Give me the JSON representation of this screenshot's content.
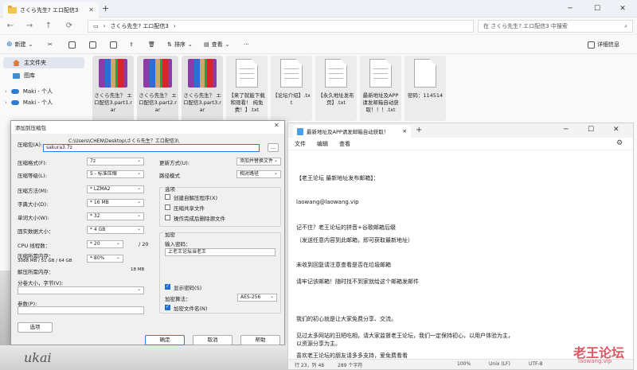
{
  "explorer": {
    "tab_title": "さくら先生? エロ配信3",
    "address": "さくら先生? エロ配信3",
    "search_placeholder": "在 さくら先生? エロ配信3 中搜索",
    "toolbar": {
      "new": "新建",
      "sort": "排序",
      "view": "查看",
      "more": "···",
      "details": "详细信息"
    },
    "sidebar": [
      {
        "label": "主文件夹",
        "icon": "home-icon"
      },
      {
        "label": "图库",
        "icon": "gallery-icon"
      },
      {
        "label": "Maki - 个人",
        "icon": "cloud-icon"
      },
      {
        "label": "Maki - 个人",
        "icon": "cloud-icon"
      }
    ],
    "files": [
      {
        "name": "さくら先生？ エロ配信3.part1.rar",
        "type": "rar"
      },
      {
        "name": "さくら先生？ エロ配信3.part2.rar",
        "type": "rar"
      },
      {
        "name": "さくら先生？ エロ配信3.part3.rar",
        "type": "rar"
      },
      {
        "name": "【来了就能下载和观看！ 纯免费！】.txt",
        "type": "txt"
      },
      {
        "name": "【论坛介绍】.txt",
        "type": "txt"
      },
      {
        "name": "【永久地址发布页】.txt",
        "type": "txt"
      },
      {
        "name": "最新地址及APP请发邮箱自动获取！！！.txt",
        "type": "txt"
      },
      {
        "name": "密码：114514",
        "type": "file"
      }
    ]
  },
  "dialog": {
    "title": "添加到压缩包",
    "archive_label": "压缩包(A):",
    "archive_path": "C:\\Users\\CHEN\\Desktop\\さくら先生？エロ配信3\\",
    "archive_name": "sakura3.7z",
    "browse": "...",
    "format_label": "压缩格式(F):",
    "format_value": "7z",
    "level_label": "压缩等级(L):",
    "level_value": "5 - 标准压缩",
    "method_label": "压缩方法(M):",
    "method_value": "* LZMA2",
    "dict_label": "字典大小(D):",
    "dict_value": "* 16 MB",
    "word_label": "单词大小(W):",
    "word_value": "* 32",
    "solid_label": "固实数据大小：",
    "solid_value": "* 4 GB",
    "cpu_label": "CPU 线程数：",
    "cpu_value": "* 20",
    "cpu_total": "/ 20",
    "mem_comp_label": "压缩所需内存：",
    "mem_comp_value": "3088 MB / 51 GB / 64 GB",
    "mem_percent": "* 80%",
    "mem_decomp_label": "解压所需内存：",
    "mem_decomp_value": "18 MB",
    "split_label": "分卷大小，字节(V):",
    "params_label": "参数(P):",
    "options_btn": "选项",
    "update_label": "更新方式(U):",
    "update_value": "添加并替换文件",
    "path_label": "路径模式",
    "path_value": "相对路径",
    "options_group": "选项",
    "opt_sfx": "创建自解压程序(X)",
    "opt_shared": "压缩共享文件",
    "opt_delete": "操作完成后删除源文件",
    "encrypt_group": "加密",
    "password_label": "输入密码：",
    "password_value": "上老王论坛当老王",
    "show_password": "显示密码(S)",
    "method_enc_label": "加密算法：",
    "method_enc_value": "AES-256",
    "encrypt_names": "加密文件名(N)",
    "ok": "确定",
    "cancel": "取消",
    "help": "帮助"
  },
  "notepad": {
    "tab_title": "最新地址及APP请发邮箱自动获取！",
    "menu": [
      "文件",
      "编辑",
      "查看"
    ],
    "lines": [
      "【老王论坛 最新地址发布邮箱】：",
      "laowang@laowang.vip",
      "记不住？老王论坛的拼音+谷歌邮箱后缀",
      "（发送任意内容到此邮箱，即可获取最新地址）",
      "未收到回复请注意查看是否在垃圾邮箱",
      "请牢记该邮箱！随时找不到家就给这个邮箱发邮件",
      "我们的初心就是让大家免费分享、交流。",
      "见过太多网站的丑陋吃相，请大家监督老王论坛，我们一定保持初心，以用户体验为主，",
      "以资源分享为主。",
      "喜欢老王论坛的朋友请多多支持，爱免费看看"
    ],
    "status": {
      "pos": "行 23，列 48",
      "chars": "289 个字符",
      "zoom": "100%",
      "eol": "Unix (LF)",
      "enc": "UTF-8"
    }
  },
  "watermark": {
    "text": "老王论坛",
    "sub": "laowang.vip"
  },
  "photo_text": "ukai"
}
